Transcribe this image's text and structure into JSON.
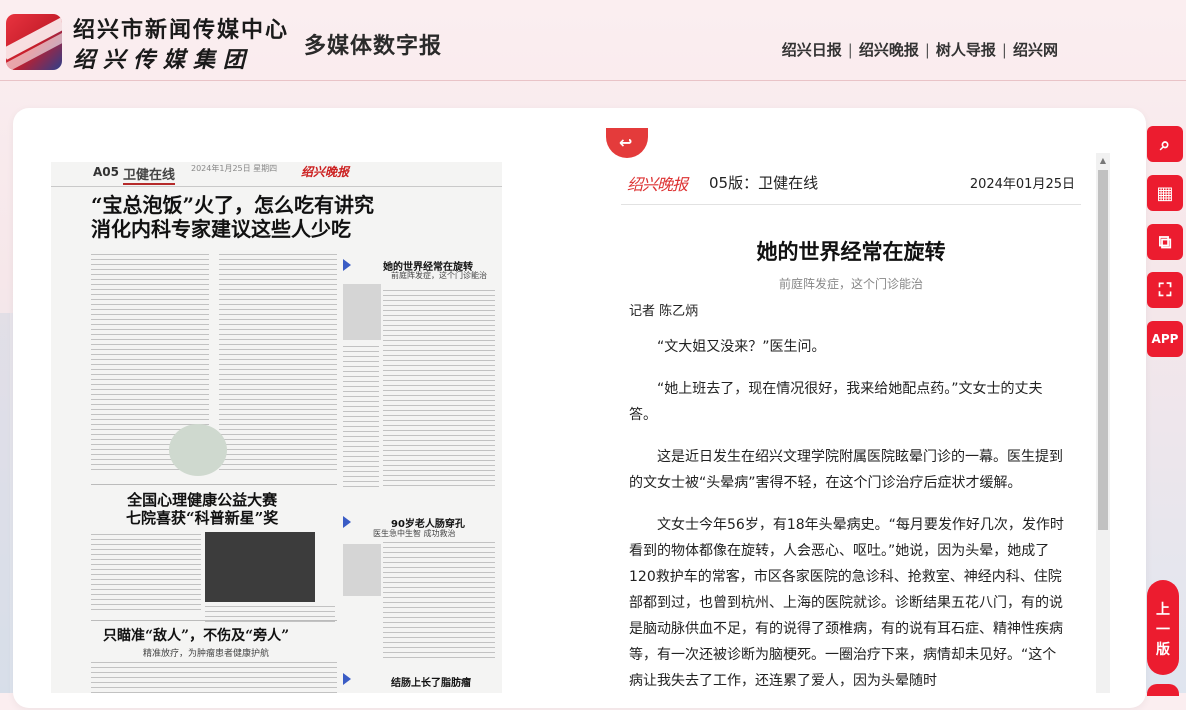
{
  "header": {
    "org_line1": "绍兴市新闻传媒中心",
    "org_line2": "绍兴传媒集团",
    "site_title": "多媒体数字报",
    "nav": [
      "绍兴日报",
      "绍兴晚报",
      "树人导报",
      "绍兴网"
    ],
    "nav_sep": "|"
  },
  "newspaper_page": {
    "page_no": "A05",
    "section": "卫健在线",
    "top_meta": "2024年1月25日 星期四",
    "paper_logo": "绍兴晚报",
    "headline1_line1": "“宝总泡饭”火了，怎么吃有讲究",
    "headline1_line2": "消化内科专家建议这些人少吃",
    "story2_title": "她的世界经常在旋转",
    "story2_sub": "前庭阵发症，这个门诊能治",
    "headline3_line1": "全国心理健康公益大赛",
    "headline3_line2": "七院喜获“科普新星”奖",
    "story4_title": "90岁老人肠穿孔",
    "story4_sub": "医生急中生智 成功救治",
    "headline5": "只瞄准“敌人”，不伤及“旁人”",
    "headline5_sub": "精准放疗，为肿瘤患者健康护航",
    "story6_title": "结肠上长了脂肪瘤"
  },
  "article": {
    "back_icon": "return-arrow-icon",
    "paper_logo": "绍兴晚报",
    "edition": "05版：卫健在线",
    "date": "2024年01月25日",
    "title": "她的世界经常在旋转",
    "subtitle": "前庭阵发症，这个门诊能治",
    "author": "记者 陈乙炳",
    "paragraphs": [
      "“文大姐又没来？”医生问。",
      "“她上班去了，现在情况很好，我来给她配点药。”文女士的丈夫答。",
      "这是近日发生在绍兴文理学院附属医院眩晕门诊的一幕。医生提到的文女士被“头晕病”害得不轻，在这个门诊治疗后症状才缓解。",
      "文女士今年56岁，有18年头晕病史。“每月要发作好几次，发作时看到的物体都像在旋转，人会恶心、呕吐。”她说，因为头晕，她成了120救护车的常客，市区各家医院的急诊科、抢救室、神经内科、住院部都到过，也曾到杭州、上海的医院就诊。诊断结果五花八门，有的说是脑动脉供血不足，有的说得了颈椎病，有的说有耳石症、精神性疾病等，有一次还被诊断为脑梗死。一圈治疗下来，病情却未见好。“这个病让我失去了工作，还连累了爱人，因为头晕随时"
    ]
  },
  "toolbar": {
    "items": [
      {
        "name": "search-tool",
        "icon": "search-icon",
        "glyph": "⌕"
      },
      {
        "name": "calendar-tool",
        "icon": "calendar-icon",
        "glyph": "▦"
      },
      {
        "name": "copy-tool",
        "icon": "copy-icon",
        "glyph": "⧉"
      },
      {
        "name": "scan-tool",
        "icon": "scan-icon",
        "glyph": "⛶"
      },
      {
        "name": "app-tool",
        "icon": "app-icon",
        "glyph": "APP"
      }
    ],
    "prev_label": [
      "上",
      "一",
      "版"
    ]
  },
  "colors": {
    "accent": "#ec1c2f",
    "paper_red": "#d33333"
  }
}
